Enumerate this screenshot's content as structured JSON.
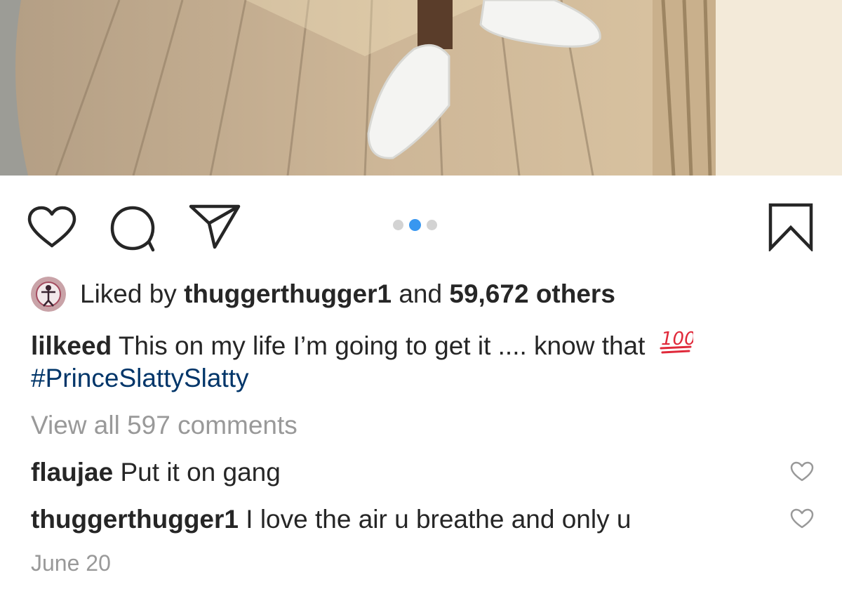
{
  "post": {
    "image_alt": "Person in white sneakers standing on a wooden deck",
    "carousel": {
      "total": 3,
      "active": 2
    },
    "liked_by": {
      "prefix": "Liked by",
      "user": "thuggerthugger1",
      "conjunction": "and",
      "others": "59,672 others"
    },
    "caption": {
      "username": "lilkeed",
      "text": "This on my life I’m going to get it .... know that",
      "emoji": "100",
      "hashtag": "#PrinceSlattySlatty"
    },
    "view_all_comments": "View all 597 comments",
    "comments": [
      {
        "username": "flaujae",
        "text": "Put it on gang"
      },
      {
        "username": "thuggerthugger1",
        "text": "I love the air u breathe and only u"
      }
    ],
    "date": "June 20"
  },
  "icons": {
    "like": "heart-outline-icon",
    "comment": "speech-bubble-icon",
    "share": "paper-plane-icon",
    "save": "bookmark-icon",
    "comment_like": "small-heart-icon"
  },
  "colors": {
    "text": "#262626",
    "muted": "#999999",
    "hashtag": "#003569",
    "dot_active": "#3897f0",
    "dot_inactive": "#d3d3d3",
    "emoji_red": "#e0293a"
  }
}
